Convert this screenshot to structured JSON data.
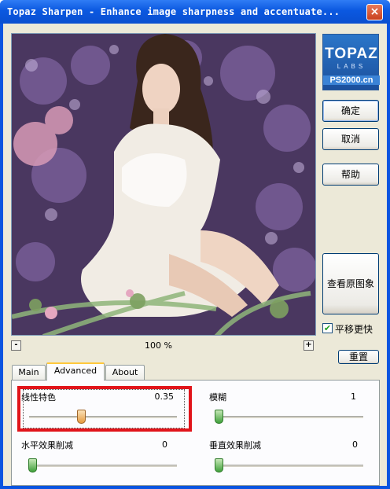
{
  "window": {
    "title": "Topaz Sharpen - Enhance image sharpness and accentuate...",
    "close_glyph": "×"
  },
  "preview": {
    "zoom_minus": "-",
    "zoom_plus": "+",
    "zoom_level": "100 %"
  },
  "logo": {
    "brand": "TOPAZ",
    "labs": "LABS",
    "site": "PS2000.cn"
  },
  "buttons": {
    "ok": "确定",
    "cancel": "取消",
    "help": "帮助",
    "view_original": "查看原图象",
    "reset": "重置"
  },
  "pan_update": {
    "label": "平移更快",
    "checked": true,
    "check_glyph": "✔"
  },
  "tabs": [
    {
      "label": "Main",
      "active": false
    },
    {
      "label": "Advanced",
      "active": true
    },
    {
      "label": "About",
      "active": false
    }
  ],
  "advanced": {
    "edge_character": {
      "label": "线性特色",
      "value": "0.35",
      "position": 0.35
    },
    "blur": {
      "label": "模糊",
      "value": "1",
      "position": 0.0
    },
    "horizontal_reduction": {
      "label": "水平效果削减",
      "value": "0",
      "position": 0.0
    },
    "vertical_reduction": {
      "label": "垂直效果削减",
      "value": "0",
      "position": 0.0
    }
  },
  "colors": {
    "titlebar": "#0b58e0",
    "highlight_box": "#e1141a",
    "dialog_bg": "#ece9d8"
  }
}
